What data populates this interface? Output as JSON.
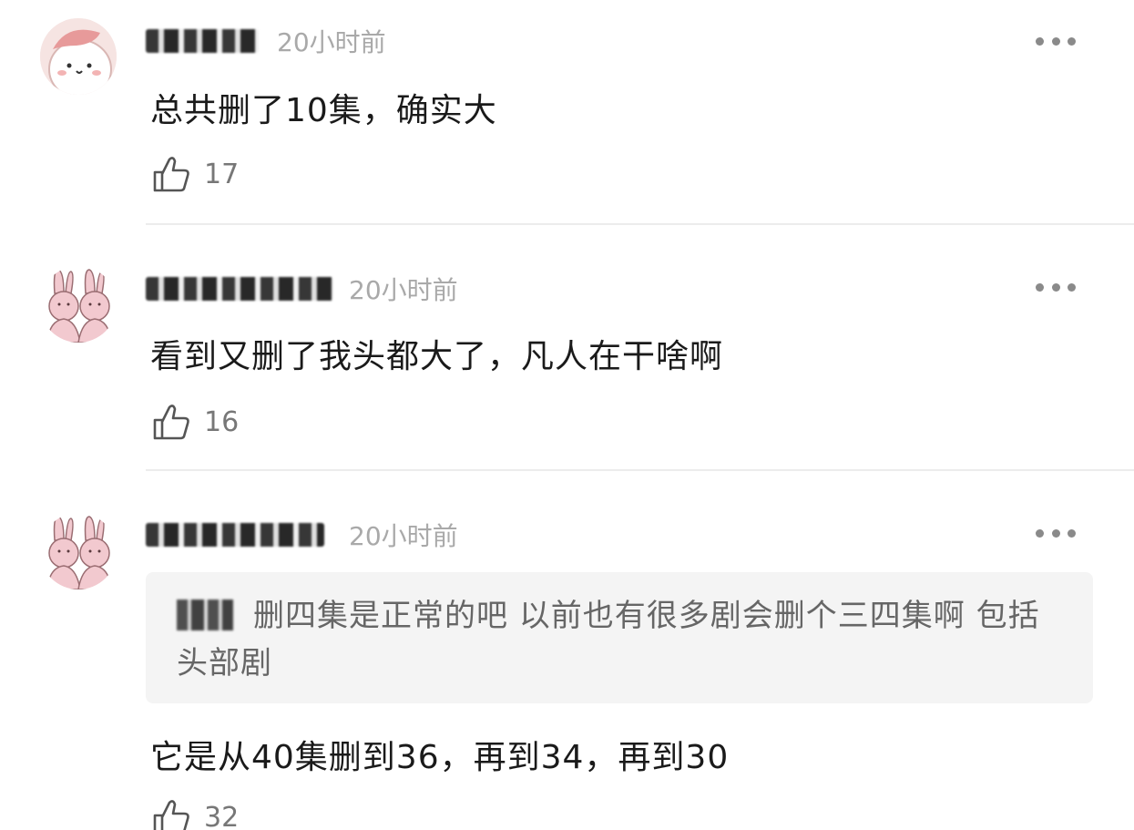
{
  "comments": [
    {
      "time": "20小时前",
      "text": "总共删了10集，确实大",
      "likes": "17",
      "avatar": "pink-bunny-face-avatar"
    },
    {
      "time": "20小时前",
      "text": "看到又删了我头都大了，凡人在干啥啊",
      "likes": "16",
      "avatar": "pink-rabbits-avatar"
    },
    {
      "time": "20小时前",
      "quote": "删四集是正常的吧 以前也有很多剧会删个三四集啊 包括头部剧",
      "text": "它是从40集删到36，再到34，再到30",
      "likes": "32",
      "avatar": "pink-rabbits-avatar"
    }
  ],
  "icons": {
    "more": "more-dots-icon",
    "like": "thumbs-up-icon"
  },
  "colors": {
    "time": "#a9a9a9",
    "body": "#1a1a1a",
    "quote_bg": "#f4f4f4",
    "quote_text": "#666666",
    "like_count": "#777777"
  }
}
